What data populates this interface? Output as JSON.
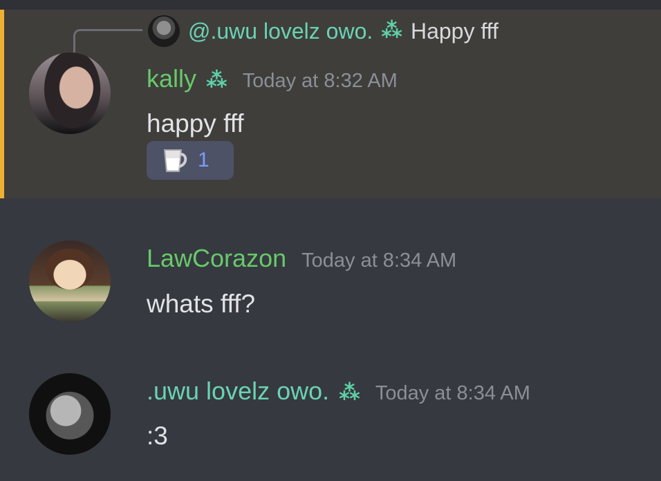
{
  "colors": {
    "background": "#36393f",
    "highlight_background": "#3f3e3b",
    "highlight_border": "#f0b132",
    "name_green": "#68c96b",
    "name_teal": "#6ad3b5",
    "timestamp": "#8b8f97",
    "message_text": "#e2e3e6",
    "reaction_background": "#4e5267",
    "reaction_count": "#7b9cff"
  },
  "messages": [
    {
      "reply": {
        "name": "@.uwu lovelz owo.",
        "badge": "⁂",
        "text": "Happy fff"
      },
      "author": "kally",
      "badge": "⁂",
      "timestamp": "Today at 8:32 AM",
      "content": "happy fff",
      "reaction": {
        "icon": "pitcher-icon",
        "count": "1"
      }
    },
    {
      "author": "LawCorazon",
      "timestamp": "Today at 8:34 AM",
      "content": "whats fff?"
    },
    {
      "author": ".uwu lovelz owo.",
      "badge": "⁂",
      "timestamp": "Today at 8:34 AM",
      "content": ":3"
    }
  ]
}
